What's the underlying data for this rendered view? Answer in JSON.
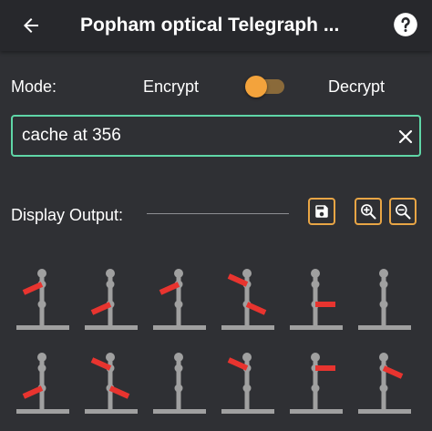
{
  "appbar": {
    "title": "Popham optical Telegraph ..."
  },
  "mode": {
    "label": "Mode:",
    "encrypt_label": "Encrypt",
    "decrypt_label": "Decrypt"
  },
  "input": {
    "value": "cache at 356"
  },
  "output": {
    "label": "Display Output:"
  },
  "icons": {
    "back": "arrow-back-icon",
    "help": "help-circle-icon",
    "clear": "close-icon",
    "save": "floppy-disk-icon",
    "zoom_in": "zoom-in-icon",
    "zoom_out": "zoom-out-icon"
  },
  "colors": {
    "background": "#2f3034",
    "appbar": "#27282c",
    "accent_orange": "#f3a33c",
    "input_border": "#5fd6a7",
    "telegraph_pole": "#a0a0a0",
    "telegraph_arm": "#e8342f"
  },
  "telegraph": {
    "rows": [
      [
        {
          "upper": "left-down",
          "lower": "none"
        },
        {
          "upper": "none",
          "lower": "left-down"
        },
        {
          "upper": "left-down",
          "lower": "none"
        },
        {
          "upper": "left-up",
          "lower": "right-down"
        },
        {
          "upper": "none",
          "lower": "right"
        },
        {
          "upper": "none",
          "lower": "none"
        }
      ],
      [
        {
          "upper": "none",
          "lower": "left-down"
        },
        {
          "upper": "left-up",
          "lower": "right-down"
        },
        {
          "upper": "none",
          "lower": "none"
        },
        {
          "upper": "left-up",
          "lower": "none"
        },
        {
          "upper": "right",
          "lower": "none"
        },
        {
          "upper": "right-down",
          "lower": "none"
        }
      ]
    ]
  }
}
